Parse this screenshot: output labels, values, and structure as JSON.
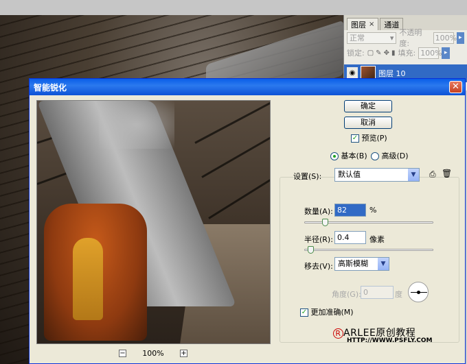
{
  "layers_panel": {
    "tabs": [
      {
        "label": "图层",
        "close": "×"
      },
      {
        "label": "通道"
      }
    ],
    "blend_mode": "正常",
    "opacity_label": "不透明度:",
    "opacity_value": "100%",
    "lock_label": "锁定:",
    "fill_label": "填充:",
    "fill_value": "100%",
    "layer_name": "图层 10"
  },
  "dialog": {
    "title": "智能锐化",
    "close_glyph": "✕",
    "ok_label": "确定",
    "cancel_label": "取消",
    "preview_label": "预览(P)",
    "preview_checked": true,
    "mode_basic": "基本(B)",
    "mode_advanced": "高级(D)",
    "settings_label": "设置(S):",
    "settings_value": "默认值",
    "amount_label": "数量(A):",
    "amount_value": "82",
    "amount_unit": "%",
    "amount_level": 0.16,
    "radius_label": "半径(R):",
    "radius_value": "0.4",
    "radius_unit": "像素",
    "radius_level": 0.05,
    "remove_label": "移去(V):",
    "remove_value": "高斯模糊",
    "angle_label": "角度(G):",
    "angle_value": "0",
    "angle_unit": "度",
    "more_accurate_label": "更加准确(M)",
    "more_accurate_checked": true,
    "zoom_minus": "−",
    "zoom_value": "100%",
    "zoom_plus": "+"
  },
  "watermark": {
    "brand": "ARLEE原创教程",
    "r_mark": "R",
    "url": "HTTP://WWW.PSFLY.COM"
  }
}
